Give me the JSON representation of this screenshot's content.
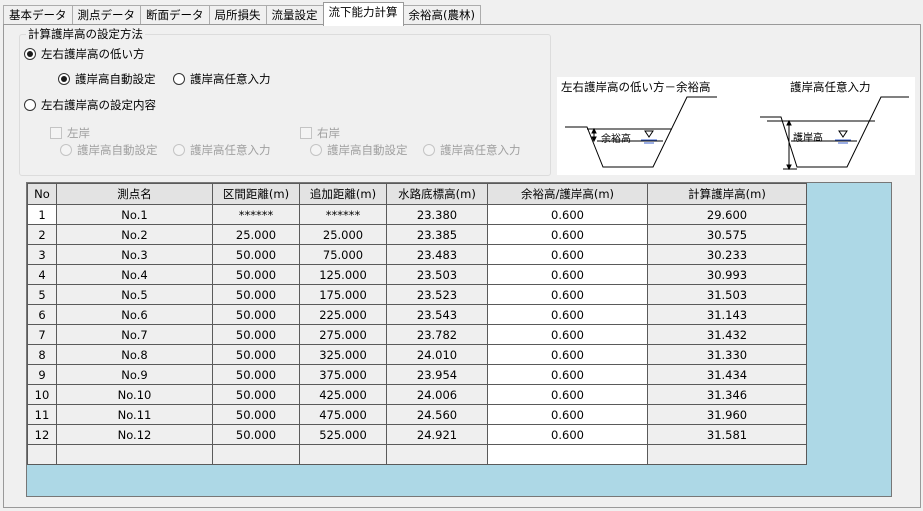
{
  "tabs": [
    {
      "label": "基本データ",
      "active": false
    },
    {
      "label": "測点データ",
      "active": false
    },
    {
      "label": "断面データ",
      "active": false
    },
    {
      "label": "局所損失",
      "active": false
    },
    {
      "label": "流量設定",
      "active": false
    },
    {
      "label": "流下能力計算",
      "active": true
    },
    {
      "label": "余裕高(農林)",
      "active": false
    }
  ],
  "settings": {
    "title": "計算護岸高の設定方法",
    "option_lower": "左右護岸高の低い方",
    "auto_set": "護岸高自動設定",
    "manual_input": "護岸高任意入力",
    "option_each": "左右護岸高の設定内容",
    "left_bank": "左岸",
    "right_bank": "右岸",
    "left_auto": "護岸高自動設定",
    "left_manual": "護岸高任意入力",
    "right_auto": "護岸高自動設定",
    "right_manual": "護岸高任意入力"
  },
  "diagram": {
    "left_caption": "左右護岸高の低い方－余裕高",
    "right_caption": "護岸高任意入力",
    "left_tag": "余裕高",
    "right_tag": "護岸高",
    "water_color": "#3a5fcd"
  },
  "table": {
    "headers": [
      "No",
      "測点名",
      "区間距離(m)",
      "追加距離(m)",
      "水路底標高(m)",
      "余裕高/護岸高(m)",
      "計算護岸高(m)"
    ],
    "rows": [
      [
        "1",
        "No.1",
        "******",
        "******",
        "23.380",
        "0.600",
        "29.600"
      ],
      [
        "2",
        "No.2",
        "25.000",
        "25.000",
        "23.385",
        "0.600",
        "30.575"
      ],
      [
        "3",
        "No.3",
        "50.000",
        "75.000",
        "23.483",
        "0.600",
        "30.233"
      ],
      [
        "4",
        "No.4",
        "50.000",
        "125.000",
        "23.503",
        "0.600",
        "30.993"
      ],
      [
        "5",
        "No.5",
        "50.000",
        "175.000",
        "23.523",
        "0.600",
        "31.503"
      ],
      [
        "6",
        "No.6",
        "50.000",
        "225.000",
        "23.543",
        "0.600",
        "31.143"
      ],
      [
        "7",
        "No.7",
        "50.000",
        "275.000",
        "23.782",
        "0.600",
        "31.432"
      ],
      [
        "8",
        "No.8",
        "50.000",
        "325.000",
        "24.010",
        "0.600",
        "31.330"
      ],
      [
        "9",
        "No.9",
        "50.000",
        "375.000",
        "23.954",
        "0.600",
        "31.434"
      ],
      [
        "10",
        "No.10",
        "50.000",
        "425.000",
        "24.006",
        "0.600",
        "31.346"
      ],
      [
        "11",
        "No.11",
        "50.000",
        "475.000",
        "24.560",
        "0.600",
        "31.960"
      ],
      [
        "12",
        "No.12",
        "50.000",
        "525.000",
        "24.921",
        "0.600",
        "31.581"
      ],
      [
        "",
        "",
        "",
        "",
        "",
        "",
        ""
      ]
    ]
  },
  "colors": {
    "grid_background": "#add8e6",
    "header_background": "#e3e3e3",
    "editable_cell": "#ffffff"
  }
}
